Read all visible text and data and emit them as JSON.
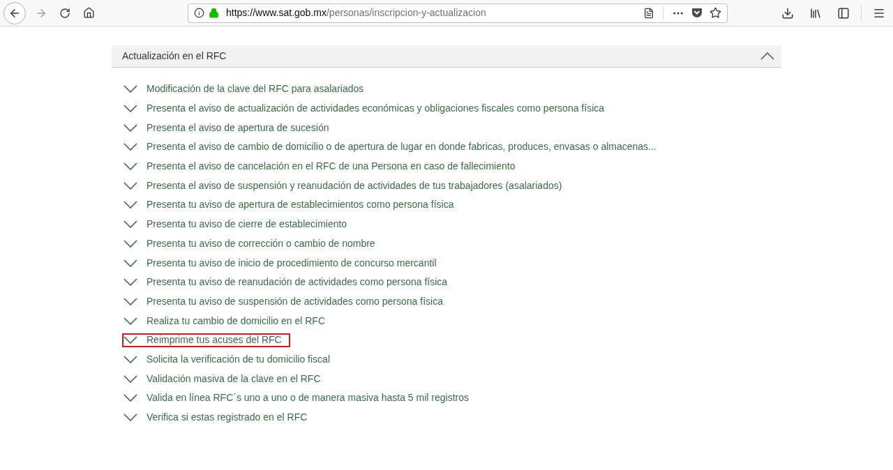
{
  "browser": {
    "url_host": "https://www.sat.gob.mx",
    "url_path": "/personas/inscripcion-y-actualizacion"
  },
  "section": {
    "title": "Actualización en el RFC",
    "expanded": true,
    "items": [
      {
        "label": "Modificación de la clave del RFC para asalariados",
        "highlighted": false
      },
      {
        "label": "Presenta el aviso de actualización de actividades económicas y obligaciones fiscales como persona física",
        "highlighted": false
      },
      {
        "label": "Presenta el aviso de apertura de sucesión",
        "highlighted": false
      },
      {
        "label": "Presenta el aviso de cambio de domicilio o de apertura de lugar en donde fabricas, produces, envasas o almacenas...",
        "highlighted": false
      },
      {
        "label": "Presenta el aviso de cancelación en el RFC de una Persona en caso de fallecimiento",
        "highlighted": false
      },
      {
        "label": "Presenta el aviso de suspensión y reanudación de actividades de tus trabajadores (asalariados)",
        "highlighted": false
      },
      {
        "label": "Presenta tu aviso de apertura de establecimientos como persona física",
        "highlighted": false
      },
      {
        "label": "Presenta tu aviso de cierre de establecimiento",
        "highlighted": false
      },
      {
        "label": "Presenta tu aviso de corrección o cambio de nombre",
        "highlighted": false
      },
      {
        "label": "Presenta tu aviso de inicio de procedimiento de concurso mercantil",
        "highlighted": false
      },
      {
        "label": "Presenta tu aviso de reanudación de actividades como persona física",
        "highlighted": false
      },
      {
        "label": "Presenta tu aviso de suspensión de actividades como persona física",
        "highlighted": false
      },
      {
        "label": "Realiza tu cambio de domicilio en el RFC",
        "highlighted": false
      },
      {
        "label": "Reimprime tus acuses del RFC",
        "highlighted": true
      },
      {
        "label": "Solicita la verificación de tu domicilio fiscal",
        "highlighted": false
      },
      {
        "label": "Validación masiva de la clave en el RFC",
        "highlighted": false
      },
      {
        "label": "Valida en línea RFC´s uno a uno o de manera masiva hasta 5 mil registros",
        "highlighted": false
      },
      {
        "label": "Verifica si estas registrado en el RFC",
        "highlighted": false
      }
    ]
  }
}
